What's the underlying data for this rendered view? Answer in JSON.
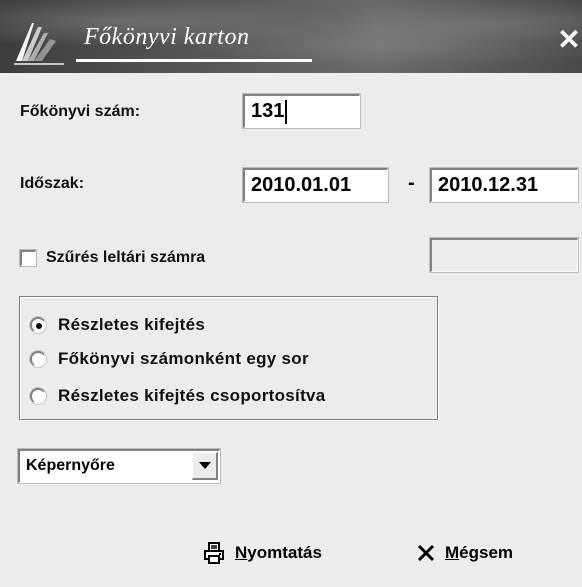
{
  "window": {
    "title": "Főkönyvi karton",
    "close_symbol": "✕"
  },
  "form": {
    "account_label": "Főkönyvi szám:",
    "account_value": "131",
    "period_label": "Időszak:",
    "period_from": "2010.01.01",
    "period_separator": "-",
    "period_to": "2010.12.31",
    "filter_checkbox_label": "Szűrés leltári számra",
    "filter_checked": false,
    "filter_value": ""
  },
  "report_options": [
    {
      "label": "Részletes kifejtés",
      "selected": true
    },
    {
      "label": "Főkönyvi számonként egy sor",
      "selected": false
    },
    {
      "label": "Részletes kifejtés csoportosítva",
      "selected": false
    }
  ],
  "output": {
    "selected": "Képernyőre"
  },
  "buttons": {
    "print_first": "N",
    "print_rest": "yomtatás",
    "cancel_first": "M",
    "cancel_rest": "égsem"
  },
  "icons": {
    "print": "printer-icon",
    "cancel": "x-icon",
    "logo": "book-logo-icon"
  },
  "colors": {
    "window_bg": "#ececec",
    "title_text": "#ffffff"
  }
}
